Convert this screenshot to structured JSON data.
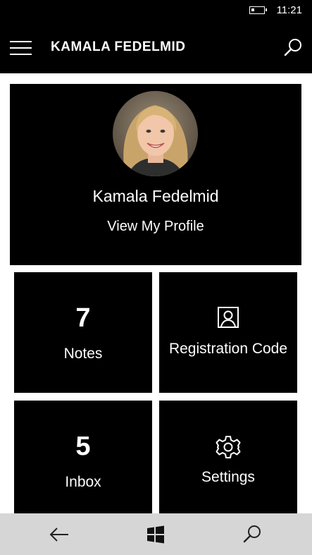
{
  "status_bar": {
    "time": "11:21",
    "battery_level": 0.25
  },
  "app_bar": {
    "title": "KAMALA FEDELMID",
    "menu_icon": "hamburger-icon",
    "search_icon": "search-icon"
  },
  "profile": {
    "name": "Kamala Fedelmid",
    "link_label": "View My Profile"
  },
  "tiles": [
    {
      "count": "7",
      "label": "Notes"
    },
    {
      "icon": "id-badge-icon",
      "label": "Registration Code"
    },
    {
      "count": "5",
      "label": "Inbox"
    },
    {
      "icon": "gear-icon",
      "label": "Settings"
    }
  ],
  "nav_bar": {
    "back_icon": "back-arrow-icon",
    "home_icon": "windows-logo-icon",
    "search_icon": "search-icon"
  },
  "colors": {
    "background": "#ffffff",
    "tile": "#000000",
    "nav_bar": "#d6d6d6"
  }
}
